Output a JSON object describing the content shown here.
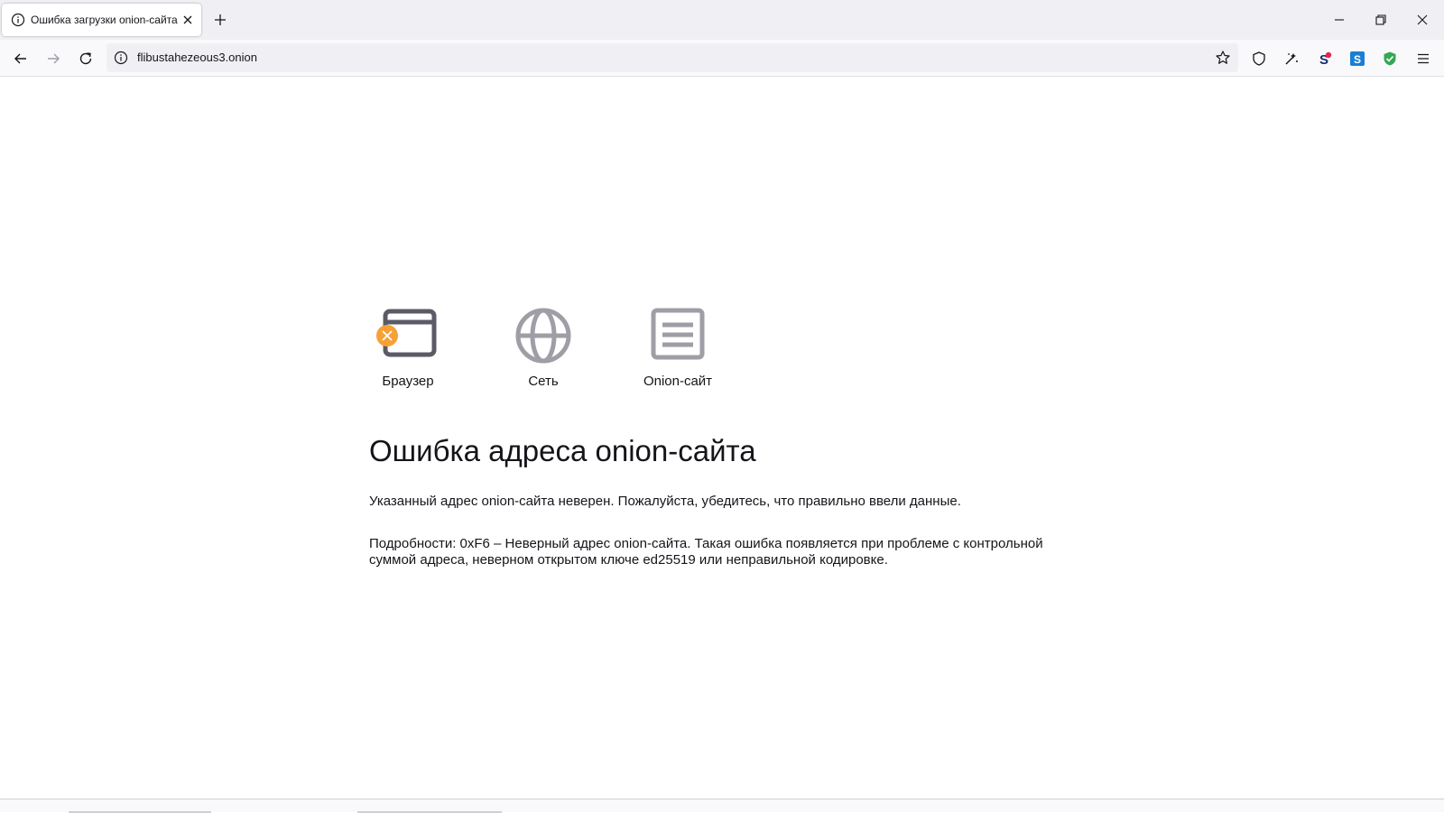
{
  "tab": {
    "title": "Ошибка загрузки onion-сайта",
    "icon": "info-icon"
  },
  "window_controls": [
    "minimize-icon",
    "restore-icon",
    "close-icon"
  ],
  "navbar": {
    "url": "flibustahezeous3.onion",
    "buttons": [
      "back-arrow-icon",
      "forward-arrow-icon",
      "reload-icon"
    ],
    "toolbar_icons": [
      "shield-icon",
      "tor-circuit-icon",
      "extension-s-red-icon",
      "extension-s-blue-icon",
      "extension-shield-green-icon",
      "hamburger-menu-icon"
    ]
  },
  "colors": {
    "accent_orange": "#f6a037",
    "icon_gray": "#5b5b66",
    "icon_light_gray": "#9e9ea6"
  },
  "status": {
    "browser_label": "Браузер",
    "network_label": "Сеть",
    "site_label": "Onion-сайт"
  },
  "error": {
    "title": "Ошибка адреса onion-сайта",
    "description": "Указанный адрес onion-сайта неверен. Пожалуйста, убедитесь, что правильно ввели данные.",
    "details": "Подробности: 0xF6 – Неверный адрес onion-сайта. Такая ошибка появляется при проблеме с контрольной суммой адреса, неверном открытом ключе ed25519 или неправильной кодировке."
  }
}
